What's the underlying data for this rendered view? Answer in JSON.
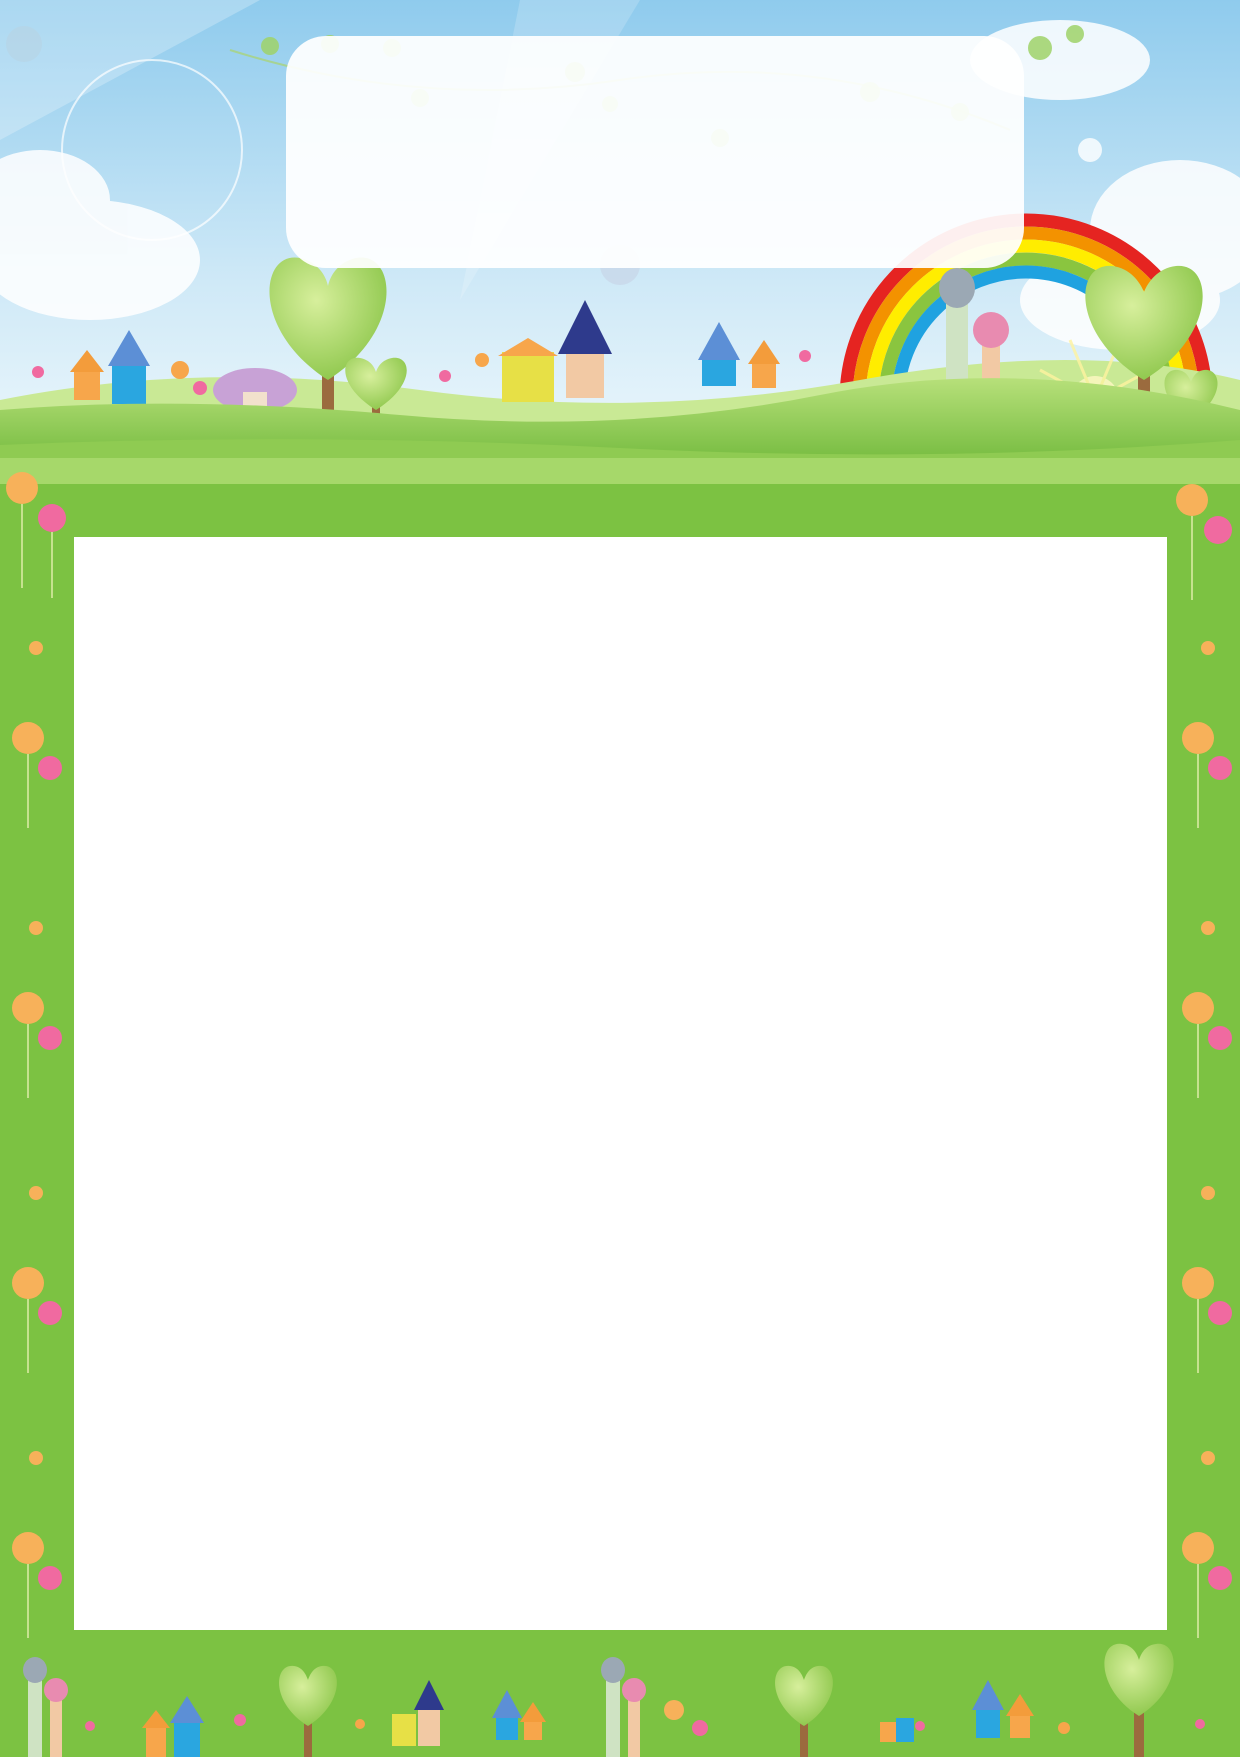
{
  "colors": {
    "sky_top": "#8ec9ec",
    "sky_bottom": "#e6f4fb",
    "frame_green": "#7cc242",
    "grass_light": "#a6d86a",
    "grass_dark": "#5aa82c",
    "panel": "#ffffff",
    "rainbow": [
      "#e52421",
      "#f39200",
      "#ffed00",
      "#8ac53f",
      "#1fa2e0"
    ]
  },
  "icons": {
    "rainbow": "rainbow-icon",
    "tree": "heart-tree-icon",
    "house": "house-icon",
    "castle": "castle-tower-icon",
    "flower": "tulip-flower-icon",
    "butterfly": "butterfly-icon",
    "sun": "sun-icon",
    "cloud": "cloud-icon",
    "mushroom": "mushroom-icon"
  },
  "title_banner": {
    "text": ""
  },
  "content_panel": {
    "text": ""
  }
}
